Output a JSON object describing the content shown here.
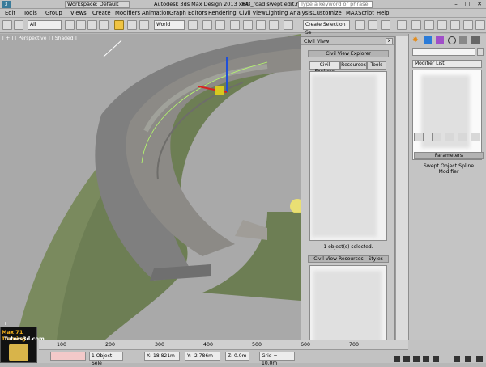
{
  "titlebar": {
    "workspace": "Workspace: Default",
    "app_title": "Autodesk 3ds Max Design 2013 x64",
    "file_title": "003_road swept edit.max",
    "search_placeholder": "Type a keyword or phrase"
  },
  "menu": [
    "Edit",
    "Tools",
    "Group",
    "Views",
    "Create",
    "Modifiers",
    "Animation",
    "Graph Editors",
    "Rendering",
    "Civil View",
    "Lighting Analysis",
    "Customize",
    "MAXScript",
    "Help"
  ],
  "toolbar": {
    "selection_filter": "All",
    "reference_coord": "World",
    "named_selection_placeholder": "Create Selection Se"
  },
  "viewport": {
    "label": "[ + ] [ Perspective ] [ Shaded ]"
  },
  "civil_view": {
    "title": "Civil View",
    "explorer_header": "Civil View Explorer",
    "tabs": [
      "Civil Explorer",
      "Resources",
      "Tools"
    ],
    "status": "1 object(s) selected.",
    "resources_header": "Civil View Resources - Styles"
  },
  "command_panel": {
    "modifier_list": "Modifier List",
    "parameters_header": "Parameters",
    "modifier_name": "Swept Object Spline Modifier"
  },
  "timeline": {
    "ticks": [
      "100",
      "200",
      "300",
      "400",
      "500",
      "600",
      "700"
    ]
  },
  "statusbar": {
    "selected": "1 Object Sele",
    "x": "X: 18.821m",
    "y": "Y: -2.786m",
    "z": "Z: 0.0m",
    "grid": "Grid = 10.0m"
  },
  "brand": {
    "line1": "Max 71 Training",
    "line2": "Tutors3d.com"
  }
}
